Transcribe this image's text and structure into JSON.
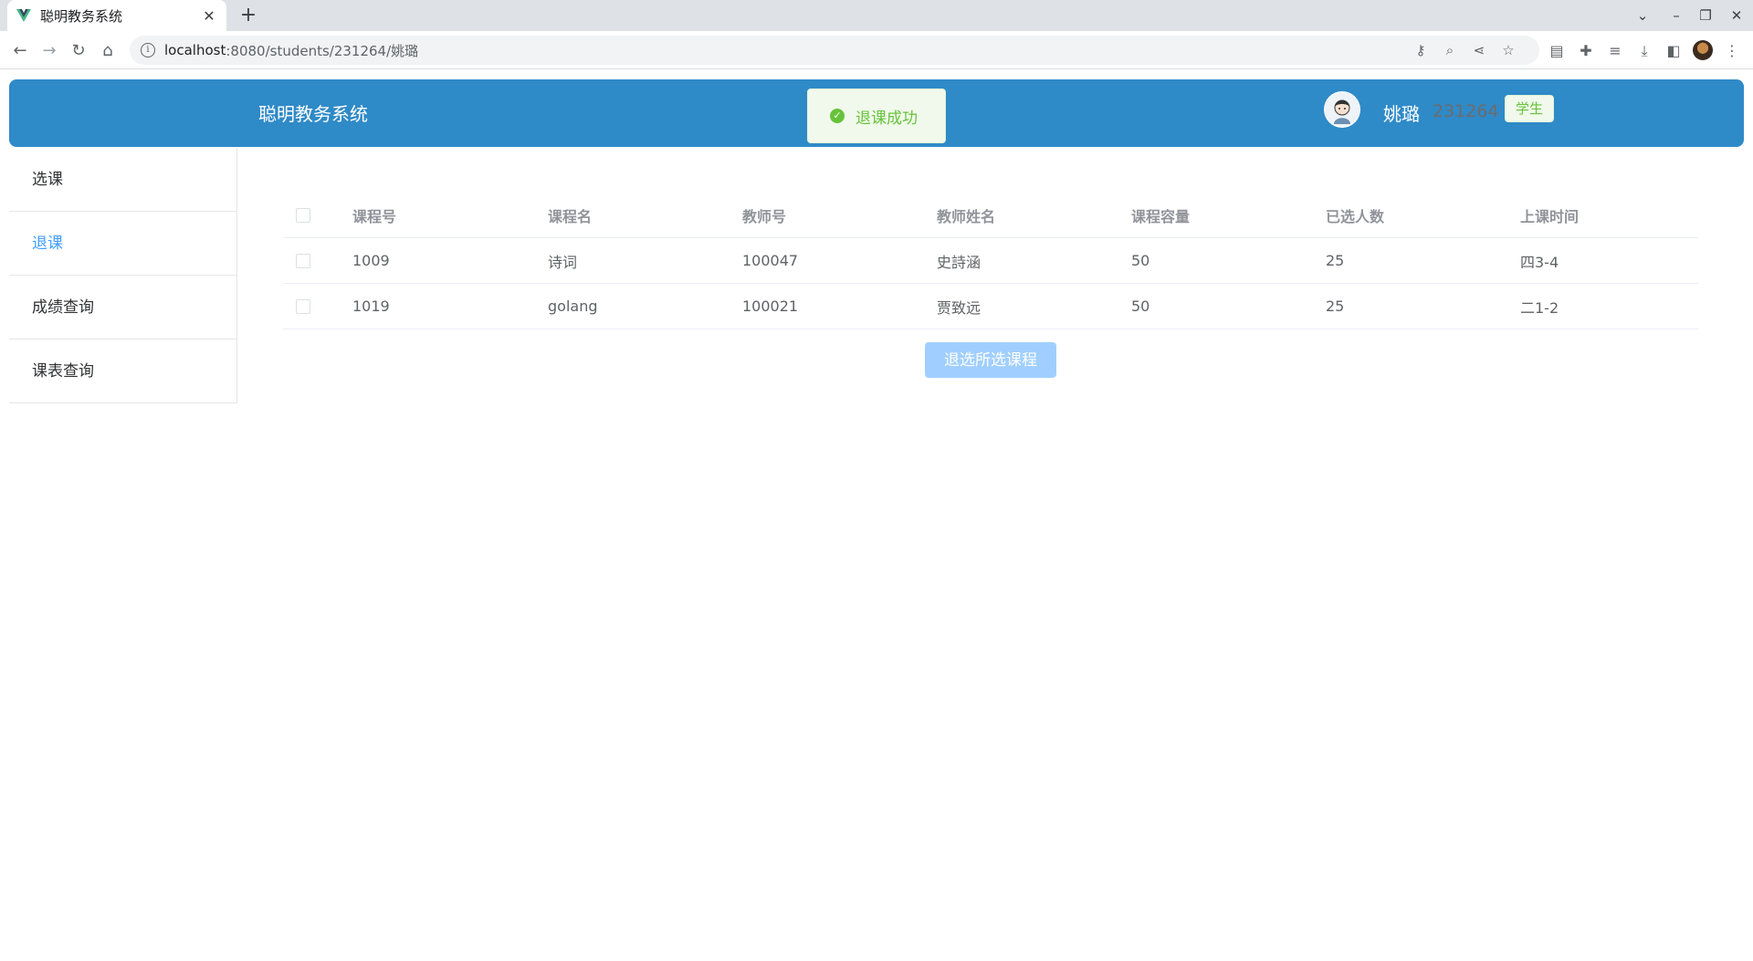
{
  "browser": {
    "tab_title": "聪明教务系统",
    "url_host": "localhost",
    "url_path": ":8080/students/231264/姚璐"
  },
  "header": {
    "app_title": "聪明教务系统",
    "user_name": "姚璐",
    "user_id": "231264",
    "role": "学生"
  },
  "toast": {
    "message": "退课成功"
  },
  "sidebar": {
    "items": [
      {
        "label": "选课"
      },
      {
        "label": "退课",
        "active": true
      },
      {
        "label": "成绩查询"
      },
      {
        "label": "课表查询"
      }
    ]
  },
  "table": {
    "columns": [
      "课程号",
      "课程名",
      "教师号",
      "教师姓名",
      "课程容量",
      "已选人数",
      "上课时间"
    ],
    "rows": [
      [
        "1009",
        "诗词",
        "100047",
        "史詩涵",
        "50",
        "25",
        "四3-4"
      ],
      [
        "1019",
        "golang",
        "100021",
        "贾致远",
        "50",
        "25",
        "二1-2"
      ]
    ]
  },
  "actions": {
    "drop_button": "退选所选课程"
  },
  "colors": {
    "header_bg": "#2f8ac8",
    "active": "#409eff",
    "success": "#67c23a",
    "button_disabled": "#a0cfff"
  }
}
